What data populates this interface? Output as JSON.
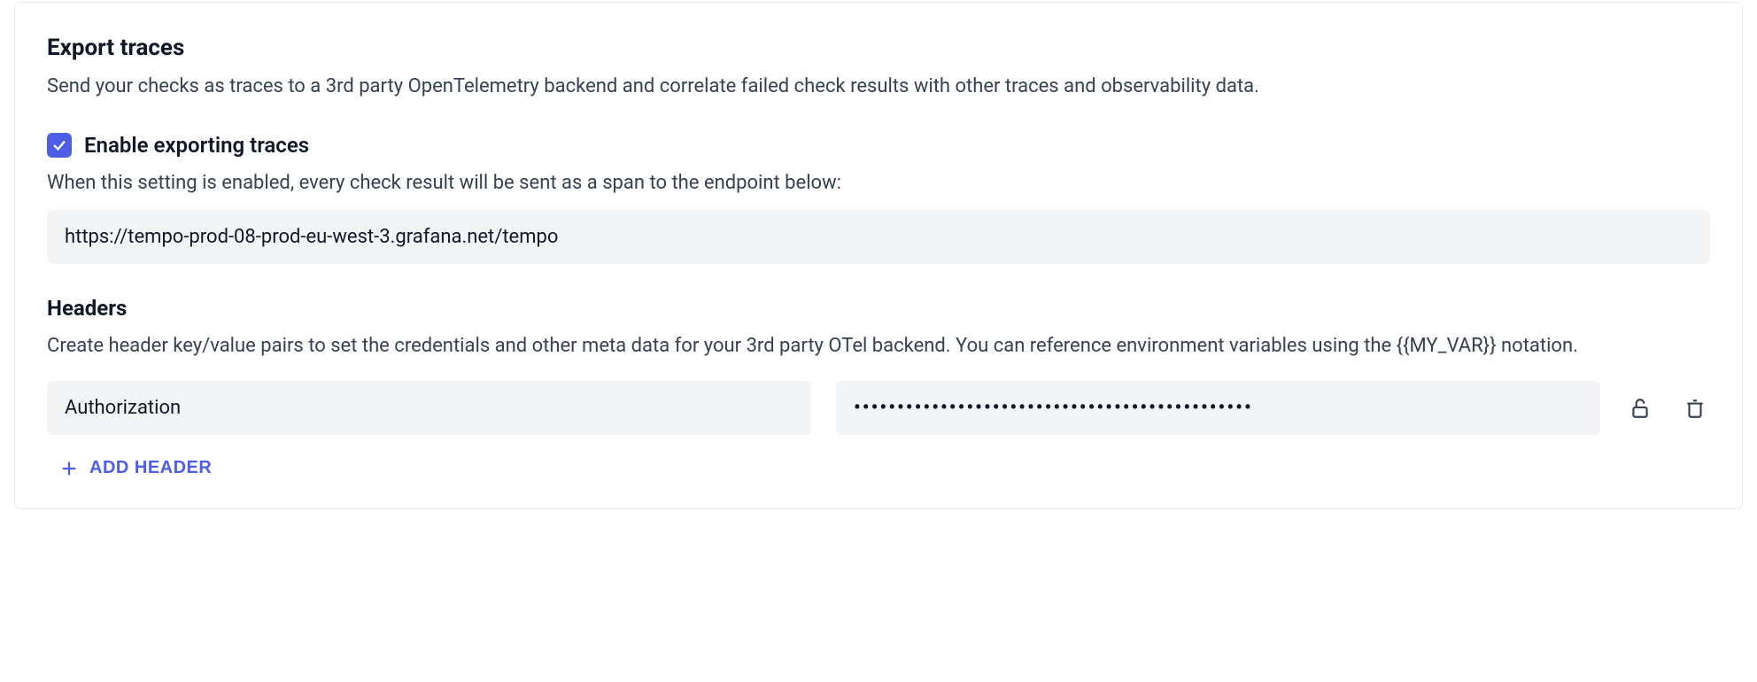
{
  "section": {
    "title": "Export traces",
    "description": "Send your checks as traces to a 3rd party OpenTelemetry backend and correlate failed check results with other traces and observability data."
  },
  "enable": {
    "label": "Enable exporting traces",
    "checked": true,
    "help": "When this setting is enabled, every check result will be sent as a span to the endpoint below:"
  },
  "endpoint": {
    "value": "https://tempo-prod-08-prod-eu-west-3.grafana.net/tempo"
  },
  "headers": {
    "title": "Headers",
    "description": "Create header key/value pairs to set the credentials and other meta data for your 3rd party OTel backend. You can reference environment variables using the {{MY_VAR}} notation.",
    "rows": [
      {
        "key": "Authorization",
        "value": "••••••••••••••••••••••••••••••••••••••••••••••",
        "locked": true
      }
    ],
    "add_label": "ADD HEADER"
  }
}
